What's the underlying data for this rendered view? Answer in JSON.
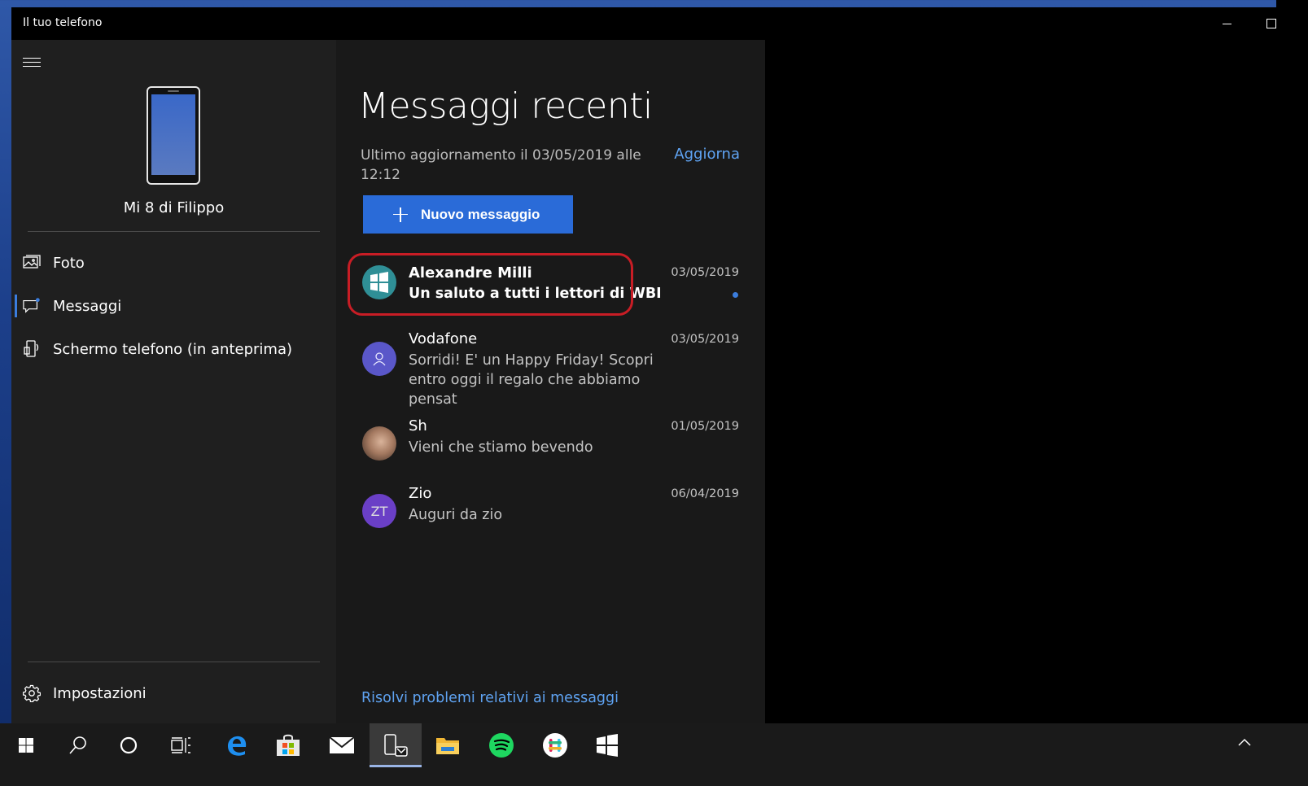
{
  "window": {
    "title": "Il tuo telefono"
  },
  "sidebar": {
    "device_name": "Mi 8 di Filippo",
    "items": [
      {
        "label": "Foto",
        "icon": "photo-icon",
        "active": false
      },
      {
        "label": "Messaggi",
        "icon": "chat-icon",
        "active": true
      },
      {
        "label": "Schermo telefono (in anteprima)",
        "icon": "phone-screen-icon",
        "active": false
      }
    ],
    "settings_label": "Impostazioni"
  },
  "main": {
    "title": "Messaggi recenti",
    "last_update": "Ultimo aggiornamento il 03/05/2019 alle 12:12",
    "refresh_label": "Aggiorna",
    "new_message_label": "Nuovo messaggio",
    "conversations": [
      {
        "name": "Alexandre Milli",
        "preview": "Un saluto a tutti i lettori di WBI",
        "date": "03/05/2019",
        "unread": true,
        "avatar": "windows-logo"
      },
      {
        "name": "Vodafone",
        "preview": "Sorridi! E' un Happy Friday! Scopri entro oggi il regalo che abbiamo pensat",
        "date": "03/05/2019",
        "unread": false,
        "avatar": "person-icon"
      },
      {
        "name": "Sh",
        "preview": "Vieni che stiamo bevendo",
        "date": "01/05/2019",
        "unread": false,
        "avatar": "photo"
      },
      {
        "name": "Zio",
        "preview": "Auguri da zio",
        "date": "06/04/2019",
        "unread": false,
        "avatar": "ZT"
      }
    ],
    "troubleshoot_label": "Risolvi problemi relativi ai messaggi"
  },
  "colors": {
    "accent": "#2a6bd8",
    "link": "#5fa3f2",
    "highlight": "#c81d25",
    "sidebar_bg": "#1f1f1f",
    "main_bg": "#191919"
  },
  "taskbar": {
    "items": [
      "windows-start-icon",
      "search-icon",
      "cortana-icon",
      "task-view-icon",
      "edge-icon",
      "store-icon",
      "mail-icon",
      "your-phone-icon",
      "file-explorer-icon",
      "spotify-icon",
      "slack-icon",
      "wbi-icon"
    ]
  }
}
